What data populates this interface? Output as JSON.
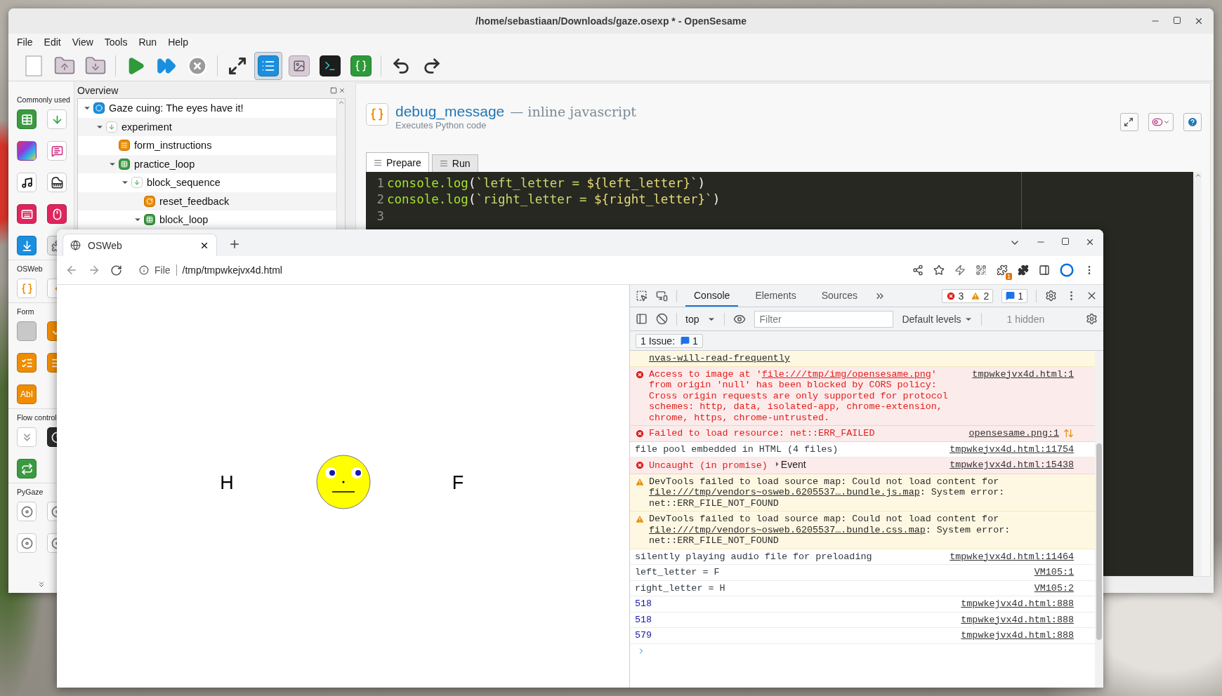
{
  "opensesame": {
    "title": "/home/sebastiaan/Downloads/gaze.osexp * - OpenSesame",
    "menu": [
      "File",
      "Edit",
      "View",
      "Tools",
      "Run",
      "Help"
    ],
    "toolbar": [
      [
        {
          "kind": "new",
          "selected": false
        },
        {
          "kind": "open",
          "selected": false
        },
        {
          "kind": "save",
          "selected": false
        }
      ],
      [
        {
          "kind": "run",
          "selected": false
        },
        {
          "kind": "quick_run",
          "selected": false
        },
        {
          "kind": "stop",
          "selected": false
        }
      ],
      [
        {
          "kind": "fullscreen",
          "selected": false
        },
        {
          "kind": "overview",
          "selected": true
        },
        {
          "kind": "pool",
          "selected": false
        },
        {
          "kind": "console",
          "selected": false
        },
        {
          "kind": "variables",
          "selected": false
        }
      ],
      [
        {
          "kind": "undo",
          "selected": false
        },
        {
          "kind": "redo",
          "selected": false
        }
      ]
    ],
    "sidebar": [
      {
        "title": "Commonly used",
        "items": [
          {
            "kind": "loop"
          },
          {
            "kind": "sequence"
          },
          {
            "kind": "sketchpad"
          },
          {
            "kind": "feedback"
          },
          {
            "kind": "sampler"
          },
          {
            "kind": "synth"
          },
          {
            "kind": "keyboard"
          },
          {
            "kind": "mouse"
          },
          {
            "kind": "logger"
          },
          {
            "kind": "plugin"
          }
        ]
      },
      {
        "title": "OSWeb",
        "items": [
          {
            "kind": "javascript"
          },
          {
            "kind": "html"
          }
        ]
      },
      {
        "title": "Form",
        "items": [
          {
            "kind": "blank"
          },
          {
            "kind": "consent"
          },
          {
            "kind": "multiple_choice"
          },
          {
            "kind": "text_display"
          },
          {
            "kind": "text_input",
            "label": "AbI"
          }
        ]
      },
      {
        "title": "Flow control",
        "items": [
          {
            "kind": "coroutines"
          },
          {
            "kind": "timer"
          },
          {
            "kind": "repeat"
          }
        ]
      },
      {
        "title": "PyGaze",
        "items": [
          {
            "kind": "tracker"
          },
          {
            "kind": "tracker"
          },
          {
            "kind": "tracker"
          },
          {
            "kind": "tracker"
          }
        ]
      }
    ],
    "overview": {
      "title": "Overview",
      "tree": [
        {
          "label": "Gaze cuing: The eyes have it!",
          "kind": "experiment",
          "expanded": true,
          "children": [
            {
              "label": "experiment",
              "kind": "sequence",
              "expanded": true,
              "children": [
                {
                  "label": "form_instructions",
                  "kind": "form"
                },
                {
                  "label": "practice_loop",
                  "kind": "loop",
                  "expanded": true,
                  "children": [
                    {
                      "label": "block_sequence",
                      "kind": "sequence",
                      "expanded": true,
                      "children": [
                        {
                          "label": "reset_feedback",
                          "kind": "reset"
                        },
                        {
                          "label": "block_loop",
                          "kind": "loop",
                          "expanded": true
                        }
                      ]
                    }
                  ]
                }
              ]
            }
          ]
        }
      ]
    },
    "editor": {
      "name": "debug_message",
      "type": "— inline javascript",
      "description": "Executes Python code",
      "tabs": [
        {
          "label": "Prepare",
          "selected": true
        },
        {
          "label": "Run",
          "selected": false
        }
      ],
      "code": [
        {
          "number": "1",
          "tokens": [
            {
              "kind": "call",
              "text": "console.log"
            },
            {
              "kind": "punct",
              "text": "("
            },
            {
              "kind": "string",
              "text": "`left_letter = "
            },
            {
              "kind": "interp",
              "text": "${left_letter}"
            },
            {
              "kind": "string",
              "text": "`"
            },
            {
              "kind": "punct",
              "text": ")"
            }
          ]
        },
        {
          "number": "2",
          "tokens": [
            {
              "kind": "call",
              "text": "console.log"
            },
            {
              "kind": "punct",
              "text": "("
            },
            {
              "kind": "string",
              "text": "`right_letter = "
            },
            {
              "kind": "interp",
              "text": "${right_letter}"
            },
            {
              "kind": "string",
              "text": "`"
            },
            {
              "kind": "punct",
              "text": ")"
            }
          ]
        },
        {
          "number": "3"
        }
      ]
    }
  },
  "browser": {
    "tab": {
      "title": "OSWeb"
    },
    "address": {
      "scheme": "File",
      "url": "/tmp/tmpwkejvx4d.html"
    },
    "extension_badge": "1",
    "page": {
      "left_letter": "H",
      "right_letter": "F"
    },
    "devtools": {
      "panel_tabs": [
        {
          "label": "Console",
          "selected": true
        },
        {
          "label": "Elements",
          "selected": false
        },
        {
          "label": "Sources",
          "selected": false
        }
      ],
      "counts": {
        "errors": "3",
        "warnings": "2",
        "messages": "1"
      },
      "context": "top",
      "filter": {
        "placeholder": "Filter"
      },
      "levels": "Default levels",
      "hidden": "1 hidden",
      "issues": {
        "label": "1 Issue:",
        "count": "1"
      },
      "messages": [
        {
          "kind": "continuation",
          "parts": [
            {
              "text": "nvas-will-read-frequently",
              "link": true
            }
          ]
        },
        {
          "kind": "error",
          "source": "tmpwkejvx4d.html:1",
          "parts": [
            {
              "text": "Access to image at '"
            },
            {
              "text": "file:///tmp/img/opensesame.png",
              "link": true
            },
            {
              "text": "' from origin 'null' has been blocked by CORS policy: Cross origin requests are only supported for protocol schemes: http, data, isolated-app, chrome-extension, chrome, https, chrome-untrusted."
            }
          ]
        },
        {
          "kind": "error",
          "source": "opensesame.png:1",
          "network": true,
          "parts": [
            {
              "text": "Failed to load resource: net::ERR_FAILED"
            }
          ]
        },
        {
          "kind": "log",
          "source": "tmpwkejvx4d.html:11754",
          "parts": [
            {
              "text": "file pool embedded in HTML (4 files)"
            }
          ]
        },
        {
          "kind": "error",
          "source": "tmpwkejvx4d.html:15438",
          "parts": [
            {
              "text": "Uncaught (in promise)"
            },
            {
              "text": "Event",
              "object": true
            }
          ]
        },
        {
          "kind": "warning",
          "parts": [
            {
              "text": "DevTools failed to load source map: Could not load content for "
            },
            {
              "text": "file:///tmp/vendors~osweb.6205537….bundle.js.map",
              "link": true
            },
            {
              "text": ": System error: net::ERR_FILE_NOT_FOUND"
            }
          ]
        },
        {
          "kind": "warning",
          "parts": [
            {
              "text": "DevTools failed to load source map: Could not load content for "
            },
            {
              "text": "file:///tmp/vendors~osweb.6205537….bundle.css.map",
              "link": true
            },
            {
              "text": ": System error: net::ERR_FILE_NOT_FOUND"
            }
          ]
        },
        {
          "kind": "log",
          "source": "tmpwkejvx4d.html:11464",
          "parts": [
            {
              "text": "silently playing audio file for preloading"
            }
          ]
        },
        {
          "kind": "log",
          "source": "VM105:1",
          "parts": [
            {
              "text": "left_letter = F"
            }
          ]
        },
        {
          "kind": "log",
          "source": "VM105:2",
          "parts": [
            {
              "text": "right_letter = H"
            }
          ]
        },
        {
          "kind": "number",
          "source": "tmpwkejvx4d.html:888",
          "parts": [
            {
              "text": "518"
            }
          ]
        },
        {
          "kind": "number",
          "source": "tmpwkejvx4d.html:888",
          "parts": [
            {
              "text": "518"
            }
          ]
        },
        {
          "kind": "number",
          "source": "tmpwkejvx4d.html:888",
          "parts": [
            {
              "text": "579"
            }
          ]
        }
      ]
    }
  }
}
